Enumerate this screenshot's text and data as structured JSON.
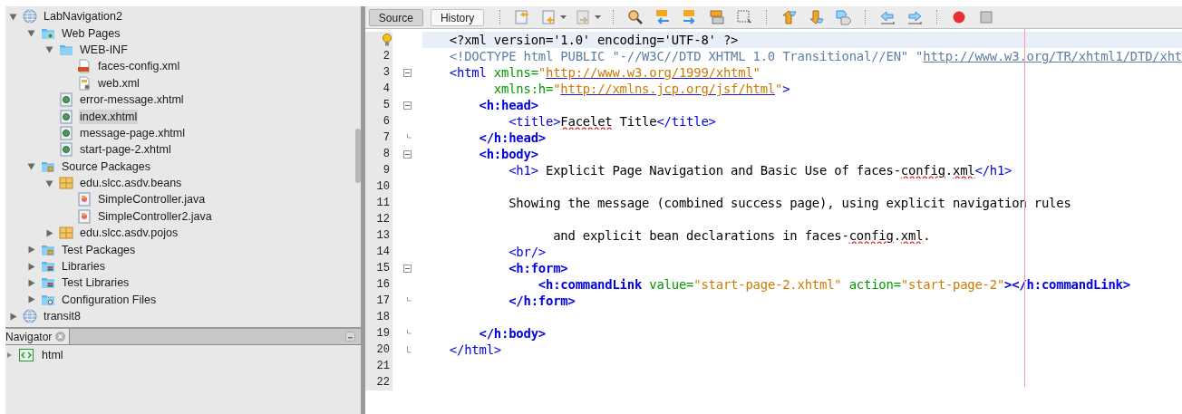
{
  "project_tree": [
    {
      "label": "LabNavigation2",
      "kind": "project",
      "expanded": true,
      "children": [
        {
          "label": "Web Pages",
          "kind": "webfolder",
          "expanded": true,
          "children": [
            {
              "label": "WEB-INF",
              "kind": "folder",
              "expanded": true,
              "children": [
                {
                  "label": "faces-config.xml",
                  "kind": "jsf",
                  "selected": false
                },
                {
                  "label": "web.xml",
                  "kind": "webxml",
                  "selected": false
                }
              ]
            },
            {
              "label": "error-message.xhtml",
              "kind": "xhtml",
              "selected": false
            },
            {
              "label": "index.xhtml",
              "kind": "xhtml",
              "selected": true
            },
            {
              "label": "message-page.xhtml",
              "kind": "xhtml",
              "selected": false
            },
            {
              "label": "start-page-2.xhtml",
              "kind": "xhtml",
              "selected": false
            }
          ]
        },
        {
          "label": "Source Packages",
          "kind": "srcfolder",
          "expanded": true,
          "children": [
            {
              "label": "edu.slcc.asdv.beans",
              "kind": "package",
              "expanded": true,
              "children": [
                {
                  "label": "SimpleController.java",
                  "kind": "java",
                  "selected": false
                },
                {
                  "label": "SimpleController2.java",
                  "kind": "java",
                  "selected": false
                }
              ]
            },
            {
              "label": "edu.slcc.asdv.pojos",
              "kind": "package",
              "expanded": false
            }
          ]
        },
        {
          "label": "Test Packages",
          "kind": "srcfolder",
          "expanded": false
        },
        {
          "label": "Libraries",
          "kind": "library",
          "expanded": false
        },
        {
          "label": "Test Libraries",
          "kind": "library",
          "expanded": false
        },
        {
          "label": "Configuration Files",
          "kind": "config",
          "expanded": false
        }
      ]
    },
    {
      "label": "transit8",
      "kind": "project",
      "expanded": false
    }
  ],
  "navigator": {
    "title": "Navigator",
    "items": [
      {
        "label": "html",
        "expanded": false
      }
    ]
  },
  "editor_tabs": [
    {
      "label": "Source",
      "selected": true
    },
    {
      "label": "History",
      "selected": false
    }
  ],
  "code_lines": [
    {
      "current": true,
      "hint": true,
      "tokens": [
        {
          "kind": "pi",
          "t": "<?xml version='1.0' encoding='UTF-8' ?>"
        }
      ]
    },
    {
      "number": "2",
      "tokens": [
        {
          "kind": "doctype",
          "t": "<!DOCTYPE html PUBLIC \"-//W3C//DTD XHTML 1.0 Transitional//EN\" \""
        },
        {
          "kind": "doclink",
          "t": "http://www.w3.org/TR/xhtml1/DTD/xht"
        }
      ]
    },
    {
      "number": "3",
      "kind": "fold-start",
      "tokens": [
        {
          "kind": "tag",
          "t": "<html "
        },
        {
          "kind": "attr",
          "t": "xmlns="
        },
        {
          "kind": "value",
          "t": "\""
        },
        {
          "kind": "link",
          "t": "http://www.w3.org/1999/xhtml"
        },
        {
          "kind": "value",
          "t": "\""
        }
      ]
    },
    {
      "number": "4",
      "tokens": [
        {
          "kind": "attr",
          "t": "      xmlns:h="
        },
        {
          "kind": "value",
          "t": "\""
        },
        {
          "kind": "link",
          "t": "http://xmlns.jcp.org/jsf/html"
        },
        {
          "kind": "value",
          "t": "\""
        },
        {
          "kind": "tag",
          "t": ">"
        }
      ]
    },
    {
      "number": "5",
      "kind": "fold-start",
      "tokens": [
        {
          "kind": "tagb",
          "t": "    <h:head>"
        }
      ]
    },
    {
      "number": "6",
      "tokens": [
        {
          "kind": "tag",
          "t": "        <title>"
        },
        {
          "kind": "typo",
          "t": "Facelet"
        },
        {
          "kind": "text",
          "t": " Title"
        },
        {
          "kind": "tag",
          "t": "</title>"
        }
      ]
    },
    {
      "number": "7",
      "kind": "fold-end",
      "tokens": [
        {
          "kind": "tagb",
          "t": "    </h:head>"
        }
      ]
    },
    {
      "number": "8",
      "kind": "fold-start",
      "tokens": [
        {
          "kind": "tagb",
          "t": "    <h:body>"
        }
      ]
    },
    {
      "number": "9",
      "tokens": [
        {
          "kind": "tag",
          "t": "        <h1>"
        },
        {
          "kind": "text",
          "t": " Explicit Page Navigation and Basic Use of faces-"
        },
        {
          "kind": "typo",
          "t": "config"
        },
        {
          "kind": "text",
          "t": "."
        },
        {
          "kind": "typo",
          "t": "xml"
        },
        {
          "kind": "tag",
          "t": "</h1>"
        }
      ]
    },
    {
      "number": "10"
    },
    {
      "number": "11",
      "tokens": [
        {
          "kind": "text",
          "t": "        Showing the message (combined success page), using explicit navigation rules"
        }
      ]
    },
    {
      "number": "12"
    },
    {
      "number": "13",
      "tokens": [
        {
          "kind": "text",
          "t": "              and explicit bean declarations in faces-"
        },
        {
          "kind": "typo",
          "t": "config"
        },
        {
          "kind": "text",
          "t": "."
        },
        {
          "kind": "typo",
          "t": "xml"
        },
        {
          "kind": "text",
          "t": "."
        }
      ]
    },
    {
      "number": "14",
      "tokens": [
        {
          "kind": "tag",
          "t": "        <br/>"
        }
      ]
    },
    {
      "number": "15",
      "kind": "fold-start",
      "tokens": [
        {
          "kind": "tagb",
          "t": "        <h:form>"
        }
      ]
    },
    {
      "number": "16",
      "tokens": [
        {
          "kind": "tagb",
          "t": "            <h:commandLink"
        },
        {
          "kind": "attr",
          "t": " value="
        },
        {
          "kind": "value",
          "t": "\"start-page-2.xhtml\""
        },
        {
          "kind": "attr",
          "t": " action="
        },
        {
          "kind": "value",
          "t": "\"start-page-2\""
        },
        {
          "kind": "tagb",
          "t": "></h:commandLink>"
        }
      ]
    },
    {
      "number": "17",
      "kind": "fold-end",
      "tokens": [
        {
          "kind": "tagb",
          "t": "        </h:form>"
        }
      ]
    },
    {
      "number": "18"
    },
    {
      "number": "19",
      "kind": "fold-end",
      "tokens": [
        {
          "kind": "tagb",
          "t": "    </h:body>"
        }
      ]
    },
    {
      "number": "20",
      "kind": "fold-last",
      "tokens": [
        {
          "kind": "tag",
          "t": "</html>"
        }
      ]
    },
    {
      "number": "21"
    },
    {
      "number": "22"
    }
  ]
}
